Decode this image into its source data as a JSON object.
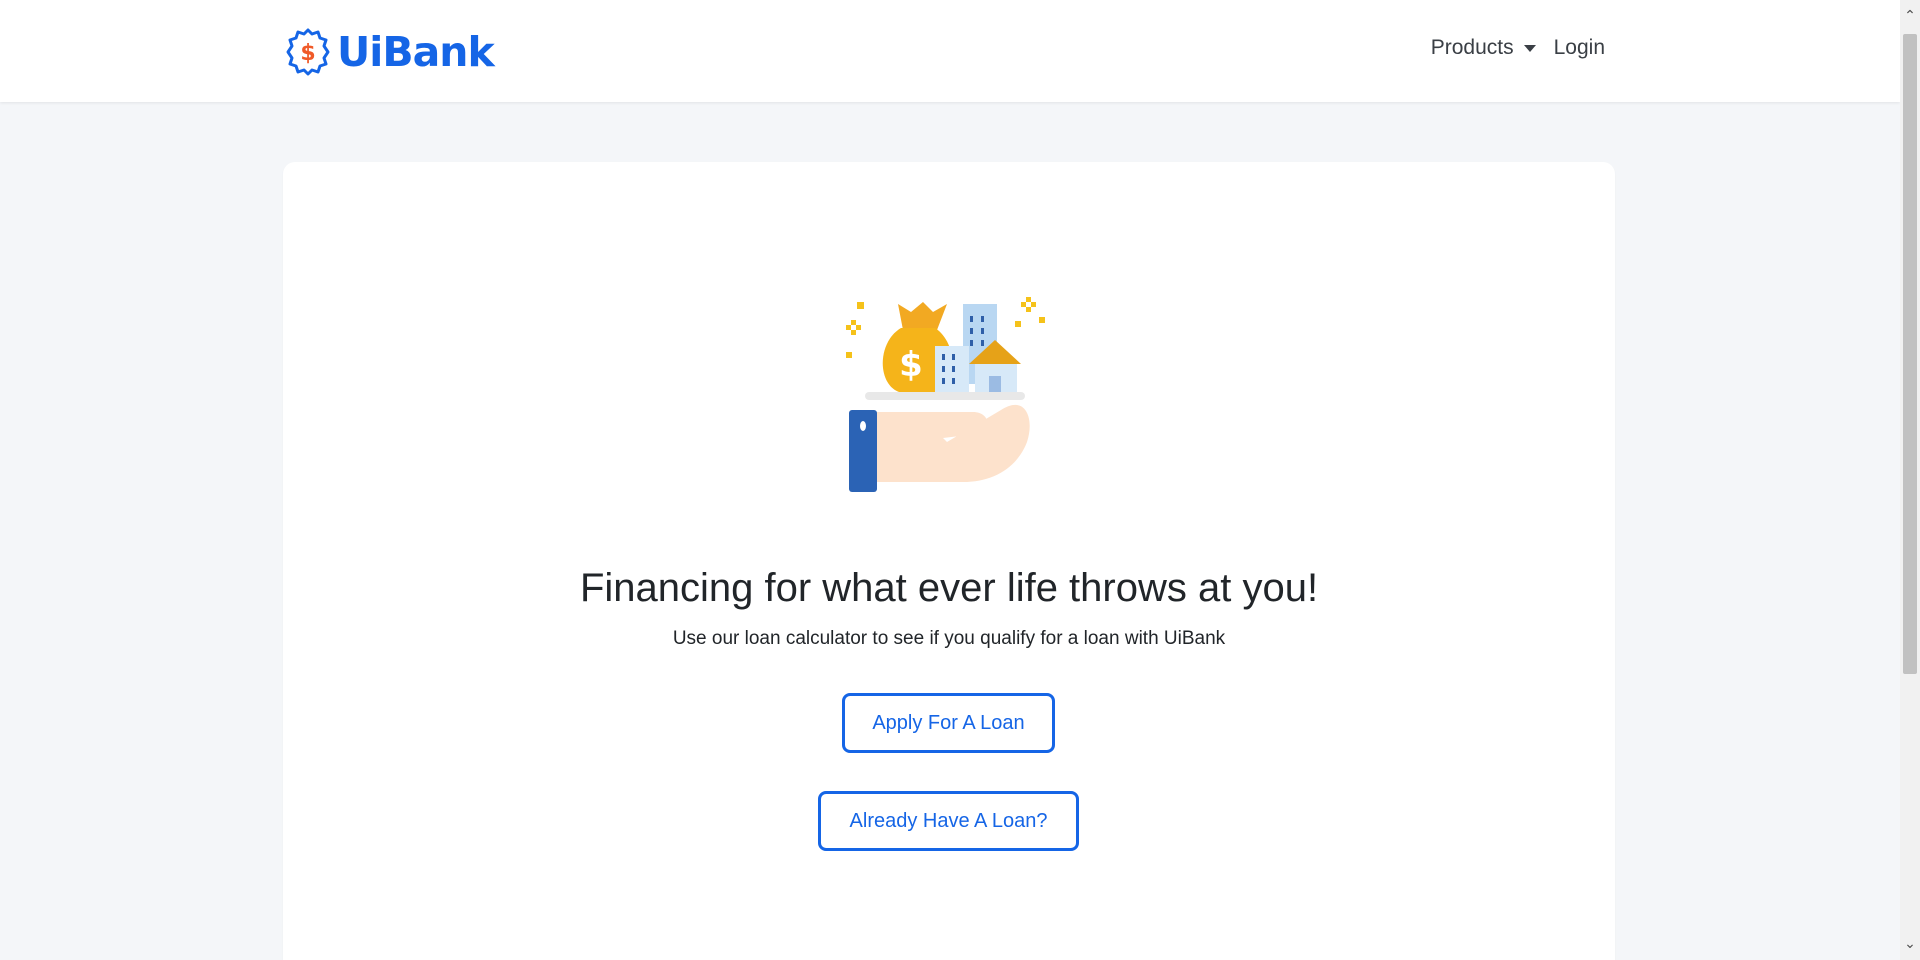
{
  "brand": {
    "name": "UiBank",
    "logo_icon": "dollar-badge-icon",
    "logo_symbol": "$",
    "color": "#1565e6",
    "accent_color": "#f05a28"
  },
  "nav": {
    "products_label": "Products",
    "login_label": "Login"
  },
  "hero": {
    "illustration": "money-bag-buildings-hand-icon",
    "title": "Financing for what ever life throws at you!",
    "subtitle": "Use our loan calculator to see if you qualify for a loan with UiBank"
  },
  "actions": {
    "apply_label": "Apply For A Loan",
    "existing_label": "Already Have A Loan?"
  },
  "scrollbar": {
    "up_icon": "chevron-up-icon",
    "down_icon": "chevron-down-icon"
  }
}
